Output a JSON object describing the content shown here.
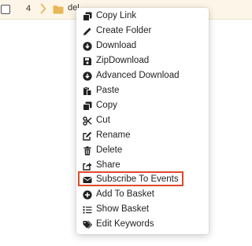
{
  "file_row": {
    "count": "4",
    "name": "del"
  },
  "menu": {
    "items": [
      {
        "label": "Copy Link",
        "icon": "copy-link-icon"
      },
      {
        "label": "Create Folder",
        "icon": "pencil-icon"
      },
      {
        "label": "Download",
        "icon": "download-icon"
      },
      {
        "label": "ZipDownload",
        "icon": "save-icon"
      },
      {
        "label": "Advanced Download",
        "icon": "download-icon"
      },
      {
        "label": "Paste",
        "icon": "paste-icon"
      },
      {
        "label": "Copy",
        "icon": "copy-icon"
      },
      {
        "label": "Cut",
        "icon": "scissors-icon"
      },
      {
        "label": "Rename",
        "icon": "edit-icon"
      },
      {
        "label": "Delete",
        "icon": "trash-icon"
      },
      {
        "label": "Share",
        "icon": "share-icon"
      },
      {
        "label": "Subscribe To Events",
        "icon": "envelope-icon"
      },
      {
        "label": "Add To Basket",
        "icon": "add-circle-icon"
      },
      {
        "label": "Show Basket",
        "icon": "list-icon"
      },
      {
        "label": "Edit Keywords",
        "icon": "tags-icon"
      }
    ],
    "highlighted_item": "Subscribe To Events"
  },
  "colors": {
    "row_background": "#fdf6e8",
    "folder": "#e8b858",
    "highlight_border": "#e0492a",
    "icon": "#222222"
  }
}
